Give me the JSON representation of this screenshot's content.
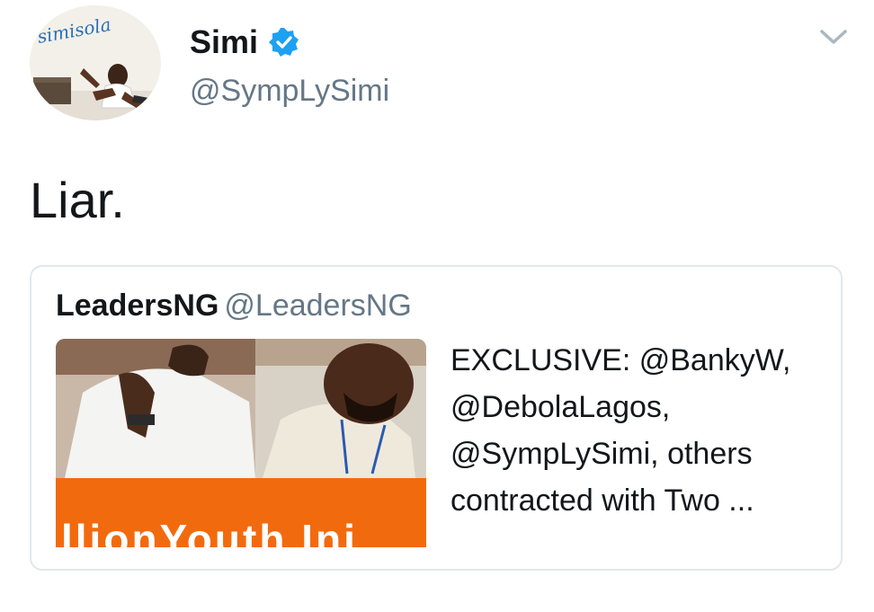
{
  "author": {
    "avatar_signature": "simisola",
    "display_name": "Simi",
    "handle": "@SympLySimi"
  },
  "tweet": {
    "text": "Liar."
  },
  "quoted_tweet": {
    "display_name": "LeadersNG",
    "handle": "@LeadersNG",
    "media_banner_text": "llionYouth Ini",
    "text": "EXCLUSIVE: @BankyW, @DebolaLagos, @SympLySimi, others contracted with Two ..."
  },
  "icons": {
    "verified": "verified-badge-icon",
    "menu": "chevron-down-icon"
  },
  "colors": {
    "verified_blue": "#1da1f2",
    "secondary_text": "#657786",
    "banner_orange": "#f26a0e",
    "border": "#e1e8ed"
  }
}
